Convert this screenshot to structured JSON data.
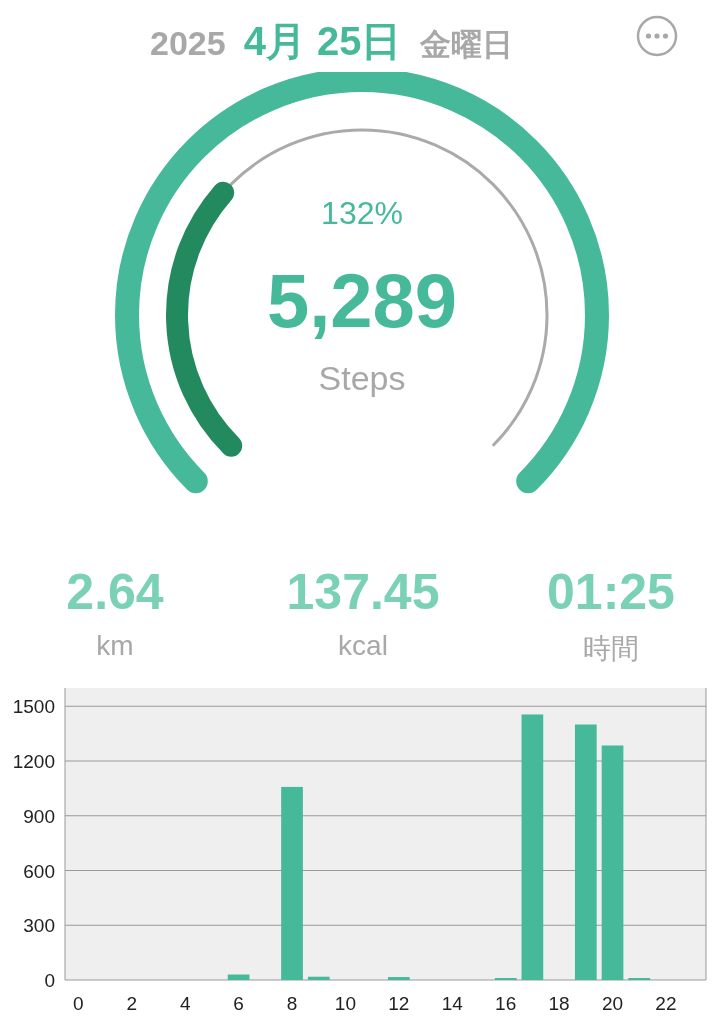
{
  "header": {
    "year": "2025",
    "date": "4月 25日",
    "weekday": "金曜日"
  },
  "gauge": {
    "percent": "132%",
    "steps": "5,289",
    "unit": "Steps",
    "goal_reached": true,
    "level": 0.32
  },
  "stats": [
    {
      "value": "2.64",
      "unit": "km"
    },
    {
      "value": "137.45",
      "unit": "kcal"
    },
    {
      "value": "01:25",
      "unit": "時間"
    }
  ],
  "chart_data": {
    "type": "bar",
    "x": [
      0,
      1,
      2,
      3,
      4,
      5,
      6,
      7,
      8,
      9,
      10,
      11,
      12,
      13,
      14,
      15,
      16,
      17,
      18,
      19,
      20,
      21,
      22,
      23
    ],
    "xlim": [
      -0.5,
      23.5
    ],
    "series": [
      {
        "color": "#45b99a",
        "values": [
          0,
          0,
          0,
          0,
          0,
          0,
          30,
          0,
          1058,
          18,
          0,
          0,
          16,
          0,
          0,
          0,
          8,
          1455,
          0,
          1400,
          1285,
          8,
          0,
          0
        ]
      }
    ],
    "xticks": [
      0,
      2,
      4,
      6,
      8,
      10,
      12,
      14,
      16,
      18,
      20,
      22
    ],
    "yticks": [
      0,
      300,
      600,
      900,
      1200,
      1500
    ],
    "ylim": [
      0,
      1600
    ],
    "grid": true
  }
}
